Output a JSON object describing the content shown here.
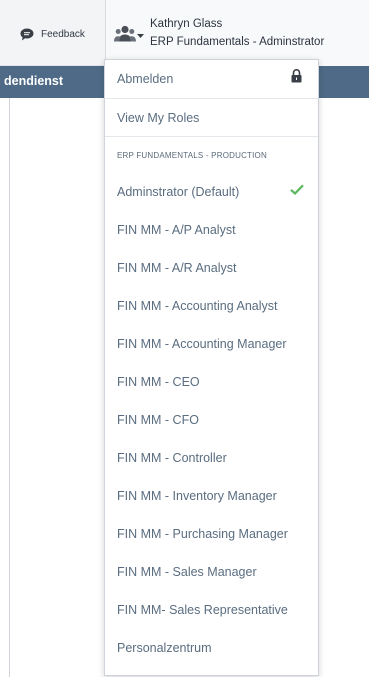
{
  "header": {
    "feedback_label": "Feedback",
    "user_name": "Kathryn Glass",
    "user_role": "ERP Fundamentals - Adminstrator"
  },
  "nav": {
    "partial_label": "dendienst"
  },
  "menu": {
    "logout_label": "Abmelden",
    "view_roles_label": "View My Roles",
    "section_label": "ERP FUNDAMENTALS - PRODUCTION",
    "roles": [
      "Adminstrator (Default)",
      "FIN MM - A/P Analyst",
      "FIN MM - A/R Analyst",
      "FIN MM - Accounting Analyst",
      "FIN MM - Accounting Manager",
      "FIN MM - CEO",
      "FIN MM - CFO",
      "FIN MM - Controller",
      "FIN MM - Inventory Manager",
      "FIN MM - Purchasing Manager",
      "FIN MM - Sales Manager",
      "FIN MM- Sales Representative",
      "Personalzentrum"
    ],
    "selected_role_index": 0
  },
  "icons": {
    "feedback": "speech-bubble-icon",
    "user": "users-group-icon",
    "caret": "caret-down-icon",
    "lock": "lock-icon",
    "check": "checkmark-icon"
  },
  "colors": {
    "nav_bar": "#4e6a86",
    "header_bg": "#f2f4f6",
    "check_green": "#5cb85c",
    "menu_text": "#5a6d80"
  }
}
